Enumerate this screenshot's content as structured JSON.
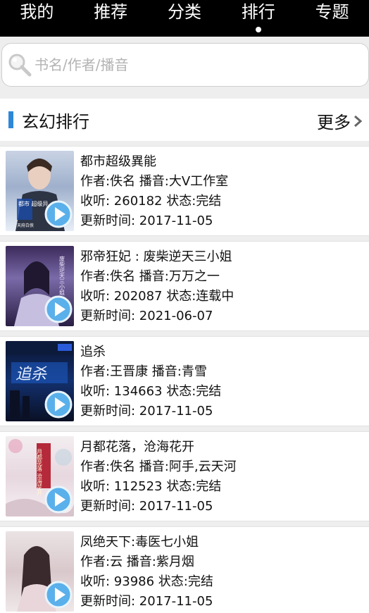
{
  "nav": {
    "tabs": [
      {
        "label": "我的"
      },
      {
        "label": "推荐"
      },
      {
        "label": "分类"
      },
      {
        "label": "排行",
        "active": true
      },
      {
        "label": "专题"
      }
    ]
  },
  "search": {
    "placeholder": "书名/作者/播音",
    "icon": "search-icon"
  },
  "section": {
    "title": "玄幻排行",
    "more_label": "更多",
    "accent_color": "#2e88d8"
  },
  "books": [
    {
      "title": "都市超级異能",
      "author_line": "作者:佚名 播音:大V工作室",
      "listen_line": "收听:  260182 状态:完结",
      "update_line": "更新时间:  2017-11-05",
      "cover_text": "都市 超级异",
      "cover_sub": "天府白侠"
    },
    {
      "title": "邪帝狂妃 :  废柴逆天三小姐",
      "author_line": "作者:佚名 播音:万万之一",
      "listen_line": "收听:  202087 状态:连载中",
      "update_line": "更新时间:  2021-06-07",
      "cover_text": "废柴逆天三小姐"
    },
    {
      "title": "追杀",
      "author_line": "作者:王晋康 播音:青雪",
      "listen_line": "收听:  134663 状态:完结",
      "update_line": "更新时间:  2017-11-05",
      "cover_text": "追杀"
    },
    {
      "title": "月都花落，沧海花开",
      "author_line": "作者:佚名 播音:阿手,云天河",
      "listen_line": "收听:  112523 状态:完结",
      "update_line": "更新时间:  2017-11-05",
      "cover_text": "月都花落 沧海花开"
    },
    {
      "title": "凤绝天下:毒医七小姐",
      "author_line": "作者:云 播音:紫月烟",
      "listen_line": "收听:  93986 状态:完结",
      "update_line": "更新时间:  2017-11-05"
    }
  ]
}
